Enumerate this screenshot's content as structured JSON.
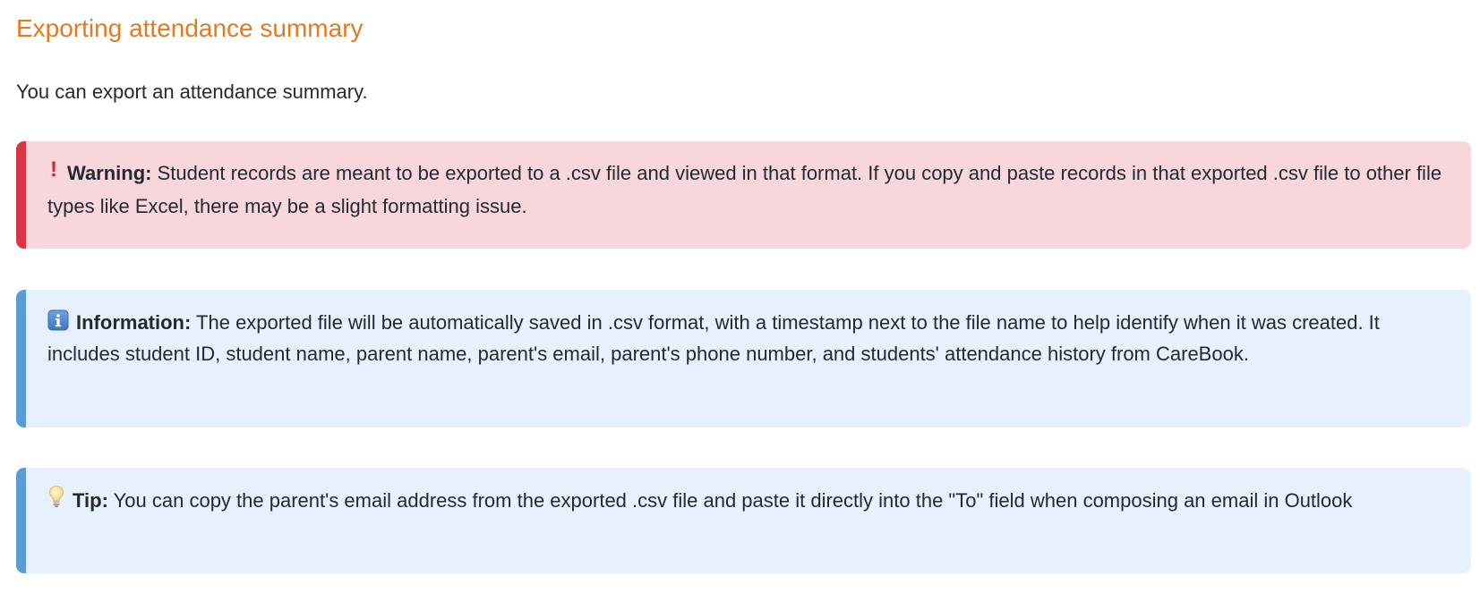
{
  "title": "Exporting attendance summary",
  "intro": "You can export an attendance summary.",
  "callouts": {
    "warning": {
      "icon": "exclamation-icon",
      "icon_glyph": "!",
      "label": "Warning:",
      "text": "Student records are meant to be exported to a .csv file and viewed in that format. If you copy and paste records in that exported .csv file to other file types like Excel, there may be a slight formatting issue.",
      "accent_color": "#d93544",
      "background_color": "#f7d7db"
    },
    "information": {
      "icon": "info-icon",
      "label": "Information:",
      "text": "The exported file will be automatically saved in .csv format, with a timestamp next to the file name to help identify when it was created. It includes student ID, student name, parent name, parent's email, parent's phone number, and students' attendance history from CareBook.",
      "accent_color": "#5a9bd5",
      "background_color": "#e6f1fd"
    },
    "tip": {
      "icon": "lightbulb-icon",
      "label": "Tip:",
      "text": "You can copy the parent's email address from the exported .csv file and paste it directly into the \"To\" field when composing an email in Outlook",
      "accent_color": "#5a9bd5",
      "background_color": "#e6f1fd"
    }
  },
  "colors": {
    "heading": "#e07b24",
    "body_text": "#24292f"
  }
}
